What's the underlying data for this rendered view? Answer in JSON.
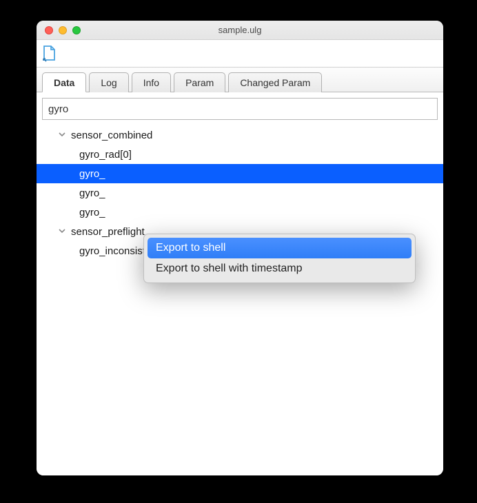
{
  "window": {
    "title": "sample.ulg"
  },
  "tabs": [
    {
      "label": "Data",
      "active": true
    },
    {
      "label": "Log",
      "active": false
    },
    {
      "label": "Info",
      "active": false
    },
    {
      "label": "Param",
      "active": false
    },
    {
      "label": "Changed Param",
      "active": false
    }
  ],
  "search": {
    "value": "gyro"
  },
  "tree": {
    "group1": {
      "label": "sensor_combined"
    },
    "item1": {
      "label": "gyro_rad[0]"
    },
    "item2": {
      "label": "gyro_"
    },
    "item3": {
      "label": "gyro_"
    },
    "item4": {
      "label": "gyro_"
    },
    "group2": {
      "label": "sensor_preflight"
    },
    "item5": {
      "label": "gyro_inconsistency_rad_s"
    }
  },
  "context_menu": {
    "items": [
      {
        "label": "Export to shell",
        "highlighted": true
      },
      {
        "label": "Export to shell with timestamp",
        "highlighted": false
      }
    ]
  }
}
